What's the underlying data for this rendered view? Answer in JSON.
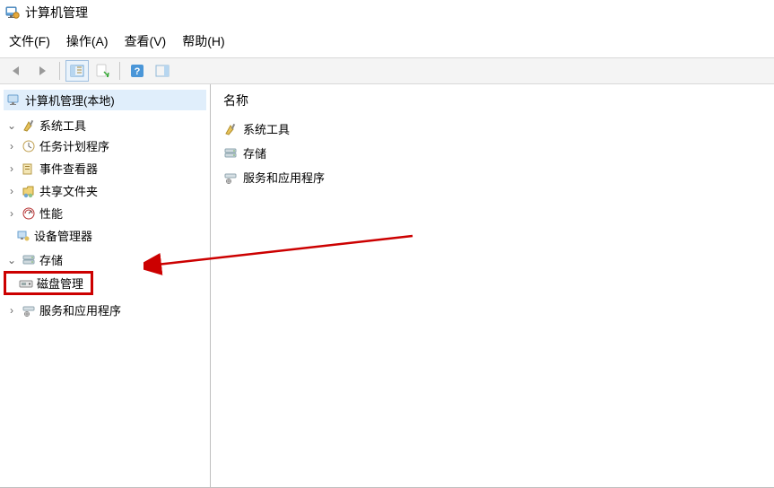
{
  "title": "计算机管理",
  "menus": {
    "file": "文件(F)",
    "action": "操作(A)",
    "view": "查看(V)",
    "help": "帮助(H)"
  },
  "tree": {
    "root": "计算机管理(本地)",
    "system_tools": "系统工具",
    "task_scheduler": "任务计划程序",
    "event_viewer": "事件查看器",
    "shared_folders": "共享文件夹",
    "performance": "性能",
    "device_manager": "设备管理器",
    "storage": "存储",
    "disk_mgmt": "磁盘管理",
    "services_apps": "服务和应用程序"
  },
  "right": {
    "header": "名称",
    "item1": "系统工具",
    "item2": "存储",
    "item3": "服务和应用程序"
  }
}
